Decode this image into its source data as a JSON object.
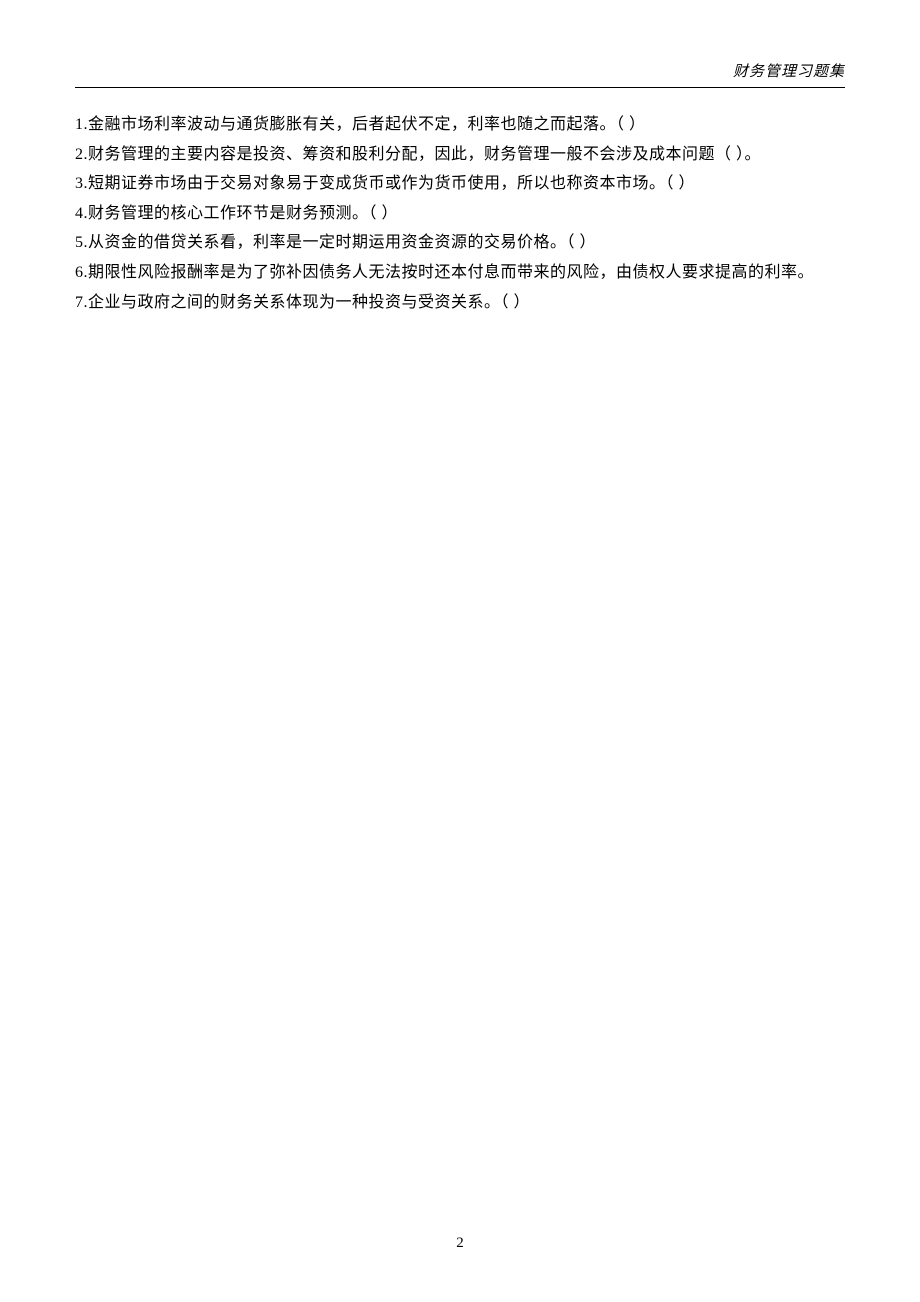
{
  "header": {
    "title": "财务管理习题集"
  },
  "questions": {
    "q1": "1.金融市场利率波动与通货膨胀有关，后者起伏不定，利率也随之而起落。（ ）",
    "q2": "2.财务管理的主要内容是投资、筹资和股利分配，因此，财务管理一般不会涉及成本问题（ ）。",
    "q3": "3.短期证券市场由于交易对象易于变成货币或作为货币使用，所以也称资本市场。（ ）",
    "q4": "4.财务管理的核心工作环节是财务预测。（ ）",
    "q5": "5.从资金的借贷关系看，利率是一定时期运用资金资源的交易价格。（ ）",
    "q6": "6.期限性风险报酬率是为了弥补因债务人无法按时还本付息而带来的风险，由债权人要求提高的利率。",
    "q7": "7.企业与政府之间的财务关系体现为一种投资与受资关系。（ ）"
  },
  "footer": {
    "page_number": "2"
  }
}
